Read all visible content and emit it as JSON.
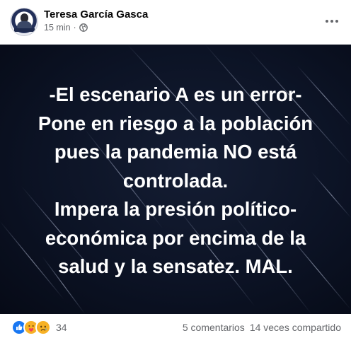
{
  "post": {
    "author": "Teresa García Gasca",
    "time": "15 min",
    "separator": "·",
    "privacy_icon": "globe-icon",
    "more_icon": "more-horizontal-icon"
  },
  "image": {
    "lines": [
      "-El escenario A es un error-",
      "Pone en riesgo a la población",
      "pues la pandemia NO está",
      "controlada.",
      "Impera la presión político-",
      "económica por encima de la",
      "salud y la sensatez. MAL."
    ],
    "background_color": "#0c1325",
    "text_color": "#ffffff"
  },
  "footer": {
    "reaction_icons": [
      "like-icon",
      "care-icon",
      "sad-icon"
    ],
    "reaction_count": "34",
    "comments": "5 comentarios",
    "shares": "14 veces compartido"
  }
}
